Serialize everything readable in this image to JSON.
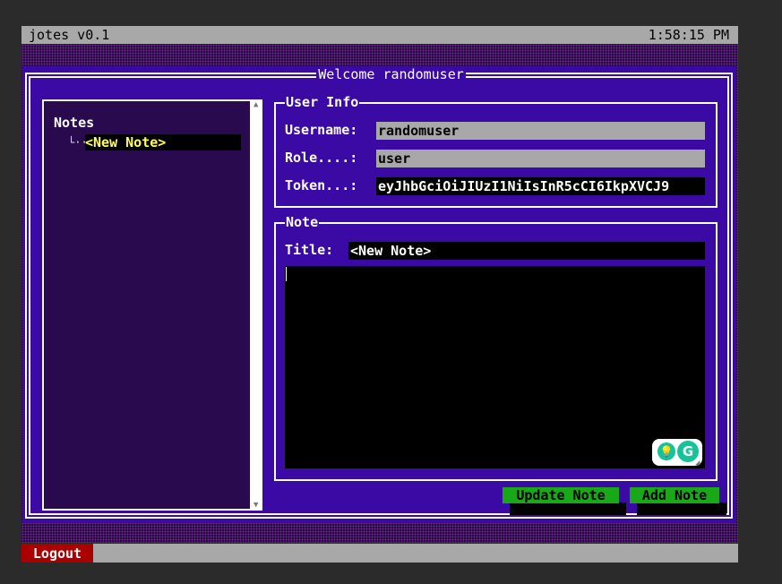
{
  "titlebar": {
    "app_name": "jotes v0.1",
    "clock": "1:58:15 PM"
  },
  "window": {
    "title": "Welcome randomuser"
  },
  "notes_tree": {
    "root_label": "Notes",
    "branch_glyph": "└··",
    "items": [
      {
        "label": "<New Note>"
      }
    ]
  },
  "scrollbar": {
    "up_glyph": "▲",
    "down_glyph": "▼"
  },
  "user_info": {
    "legend": "User Info",
    "username_label": "Username:",
    "username_value": "randomuser",
    "role_label": "Role....:",
    "role_value": "user",
    "token_label": "Token...:",
    "token_value": "eyJhbGciOiJIUzI1NiIsInR5cCI6IkpXVCJ9"
  },
  "note": {
    "legend": "Note",
    "title_label": "Title:",
    "title_value": "<New Note>",
    "body_value": ""
  },
  "grammarly": {
    "bulb_glyph": "💡",
    "logo_glyph": "G"
  },
  "resize_glyph": "◢",
  "buttons": {
    "update_note": "Update Note",
    "add_note": "Add Note"
  },
  "statusbar": {
    "logout": "Logout"
  },
  "colors": {
    "window_bg": "#3b0aa4",
    "notes_bg": "#2a0a4f",
    "highlight_text": "#ffff55",
    "button_green": "#18a818",
    "logout_red": "#aa0000",
    "field_grey": "#a8a8a8"
  }
}
